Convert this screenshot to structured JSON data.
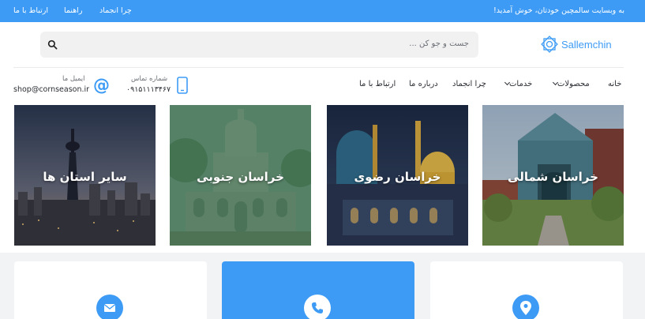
{
  "topbar": {
    "welcome": "به وبسایت سالمچین خودتان، خوش آمدید!",
    "links": [
      "چرا انجماد",
      "راهنما",
      "ارتباط با ما"
    ]
  },
  "logo": {
    "text": "Sallemchin"
  },
  "search": {
    "placeholder": "جست و جو کن ..."
  },
  "nav": {
    "home": "خانه",
    "products": "محصولات",
    "services": "خدمات",
    "why_freezing": "چرا انجماد",
    "about": "درباره ما",
    "contact": "ارتباط با ما"
  },
  "contact": {
    "phone_label": "شماره تماس",
    "phone_value": "۰۹۱۵۱۱۱۳۴۶۷",
    "email_label": "ایمیل ما",
    "email_value": "shop@cornseason.ir"
  },
  "cards": [
    {
      "title": "خراسان شمالی"
    },
    {
      "title": "خراسان رضوی"
    },
    {
      "title": "خراسان جنوبی"
    },
    {
      "title": "سایر استان ها"
    }
  ],
  "features": [
    {
      "icon": "location-icon"
    },
    {
      "icon": "phone-icon"
    },
    {
      "icon": "mail-icon"
    }
  ],
  "colors": {
    "accent": "#3d9bf5",
    "overlay_green": "#3f7a52"
  }
}
